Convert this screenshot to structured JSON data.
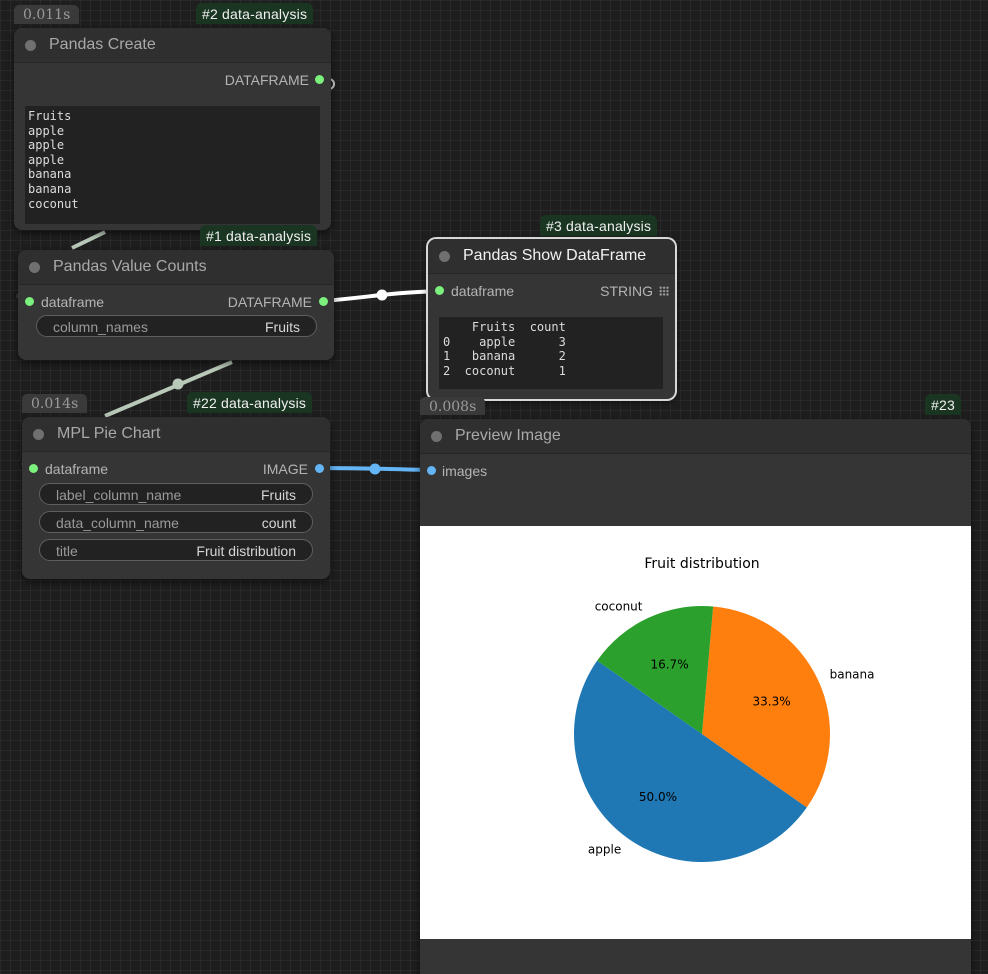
{
  "nodes": {
    "pandas_create": {
      "timer": "0.011s",
      "badge": "#2 data-analysis",
      "title": "Pandas Create",
      "output": "DATAFRAME",
      "text_lines": [
        "Fruits",
        "apple",
        "apple",
        "apple",
        "banana",
        "banana",
        "coconut"
      ]
    },
    "value_counts": {
      "badge": "#1 data-analysis",
      "title": "Pandas Value Counts",
      "input": "dataframe",
      "output": "DATAFRAME",
      "widgets": [
        {
          "name": "column_names",
          "value": "Fruits"
        }
      ]
    },
    "show_dataframe": {
      "badge": "#3 data-analysis",
      "title": "Pandas Show DataFrame",
      "input": "dataframe",
      "output": "STRING",
      "table_lines": [
        "    Fruits  count",
        "0    apple      3",
        "1   banana      2",
        "2  coconut      1"
      ]
    },
    "pie_chart": {
      "timer": "0.014s",
      "badge": "#22 data-analysis",
      "title": "MPL Pie Chart",
      "input": "dataframe",
      "output": "IMAGE",
      "widgets": [
        {
          "name": "label_column_name",
          "value": "Fruits"
        },
        {
          "name": "data_column_name",
          "value": "count"
        },
        {
          "name": "title",
          "value": "Fruit distribution"
        }
      ]
    },
    "preview": {
      "timer": "0.008s",
      "badge": "#23",
      "title": "Preview Image",
      "input": "images"
    }
  },
  "colors": {
    "dataframe_link": "#b9c9b9",
    "string_link": "#ffffff",
    "image_link": "#64b5f6",
    "badge_bg": "#1a3522"
  },
  "chart_data": {
    "type": "pie",
    "title": "Fruit distribution",
    "slices": [
      {
        "label": "apple",
        "value": 3,
        "pct": "50.0%",
        "color": "#1f77b4"
      },
      {
        "label": "banana",
        "value": 2,
        "pct": "33.3%",
        "color": "#ff7f0e"
      },
      {
        "label": "coconut",
        "value": 1,
        "pct": "16.7%",
        "color": "#2ca02c"
      }
    ],
    "startangle": 0,
    "counterclock": true,
    "legend": "none"
  }
}
